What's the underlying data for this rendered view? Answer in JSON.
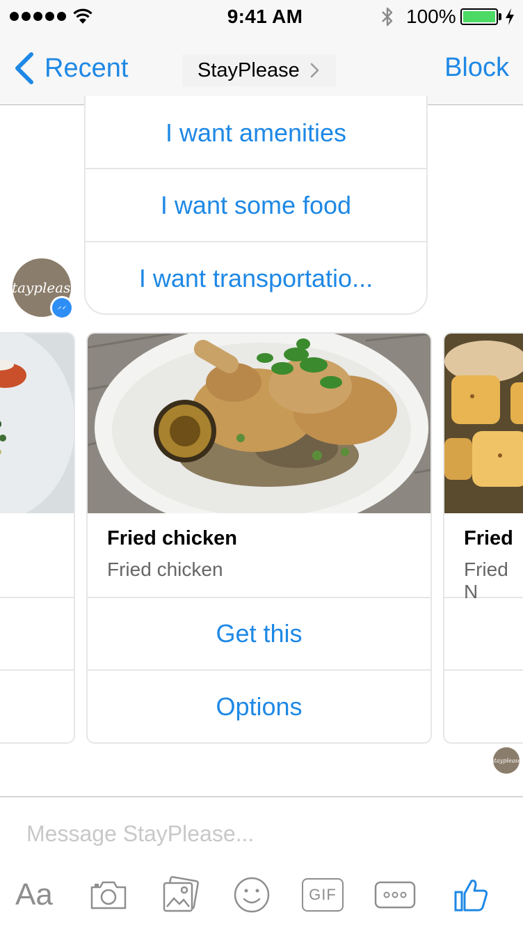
{
  "status_bar": {
    "time": "9:41 AM",
    "battery": "100%",
    "battery_level": 1.0
  },
  "nav": {
    "back_label": "Recent",
    "title": "StayPlease",
    "block_label": "Block"
  },
  "quick_replies": [
    {
      "label": "I want amenities"
    },
    {
      "label": "I want some food"
    },
    {
      "label": "I want transportatio..."
    }
  ],
  "avatar": {
    "text": "stayplease"
  },
  "carousel": {
    "main": {
      "title": "Fried chicken",
      "subtitle": "Fried chicken",
      "buttons": [
        "Get this",
        "Options"
      ]
    },
    "right_partial": {
      "title": "Fried",
      "subtitle": "Fried N"
    }
  },
  "composer": {
    "placeholder": "Message StayPlease...",
    "text_label": "Aa",
    "gif_label": "GIF"
  },
  "colors": {
    "accent": "#1e88e5",
    "battery": "#4cd964",
    "avatar_bg": "#8b7d6b"
  }
}
